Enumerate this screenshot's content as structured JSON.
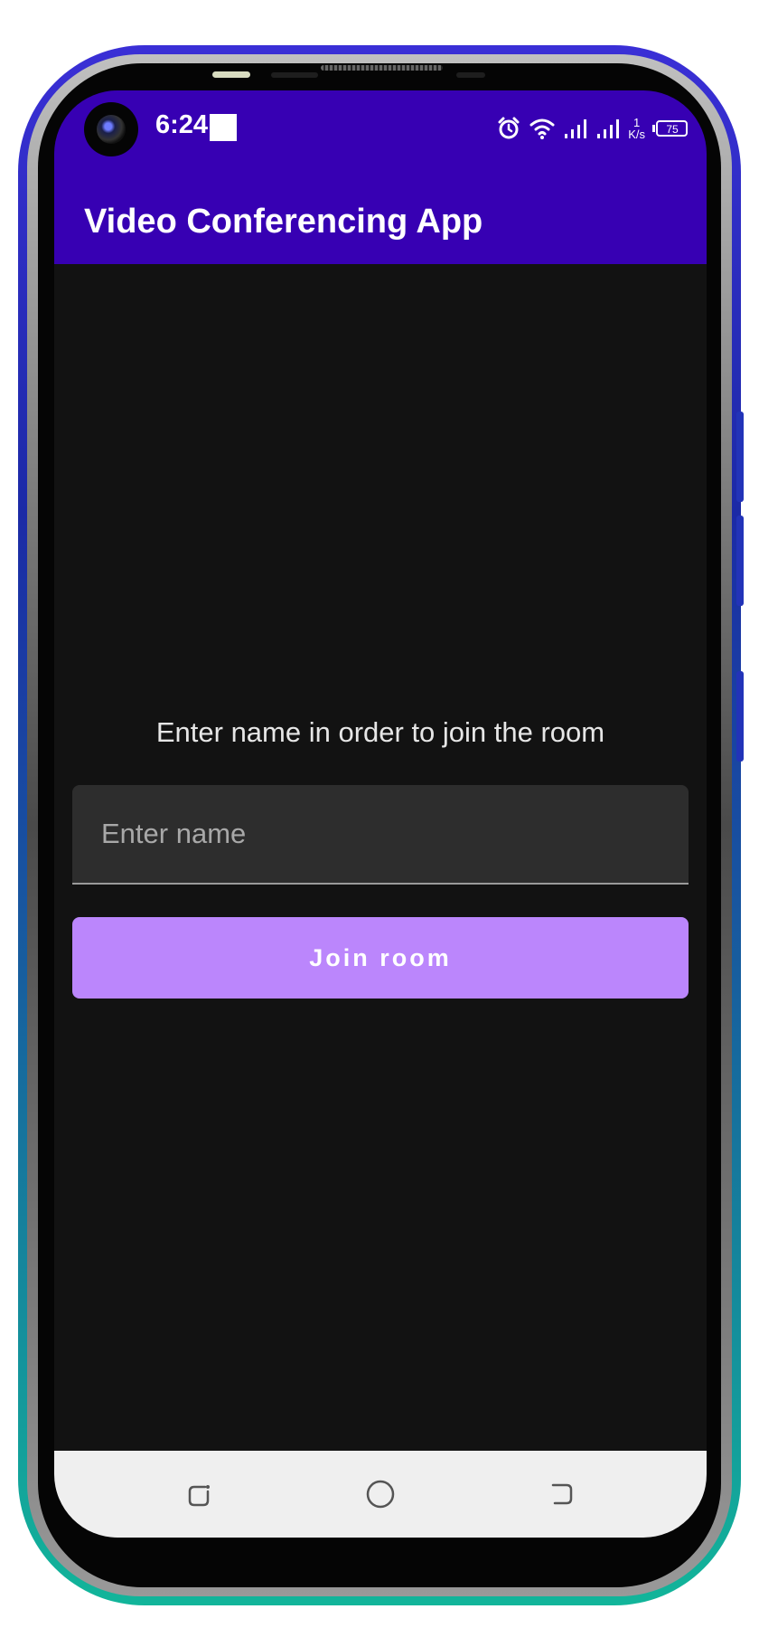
{
  "status_bar": {
    "time": "6:24",
    "network_speed_value": "1",
    "network_speed_unit": "K/s",
    "battery_level": "75",
    "icons": [
      "front-camera-icon",
      "notification-square-icon",
      "alarm-icon",
      "wifi-icon",
      "signal-icon",
      "signal-icon",
      "battery-icon"
    ]
  },
  "app_bar": {
    "title": "Video Conferencing App"
  },
  "join_form": {
    "prompt": "Enter name in order to join the room",
    "name_value": "",
    "name_placeholder": "Enter name",
    "join_label": "Join room"
  },
  "navigation_bar": {
    "icons": [
      "recent-apps-icon",
      "home-icon",
      "back-icon"
    ]
  },
  "colors": {
    "status_bar": "#3700b3",
    "app_bar": "#3700b3",
    "background": "#121212",
    "text_field": "#2d2d2d",
    "button": "#bb86fc",
    "nav_bar": "#efefef"
  }
}
